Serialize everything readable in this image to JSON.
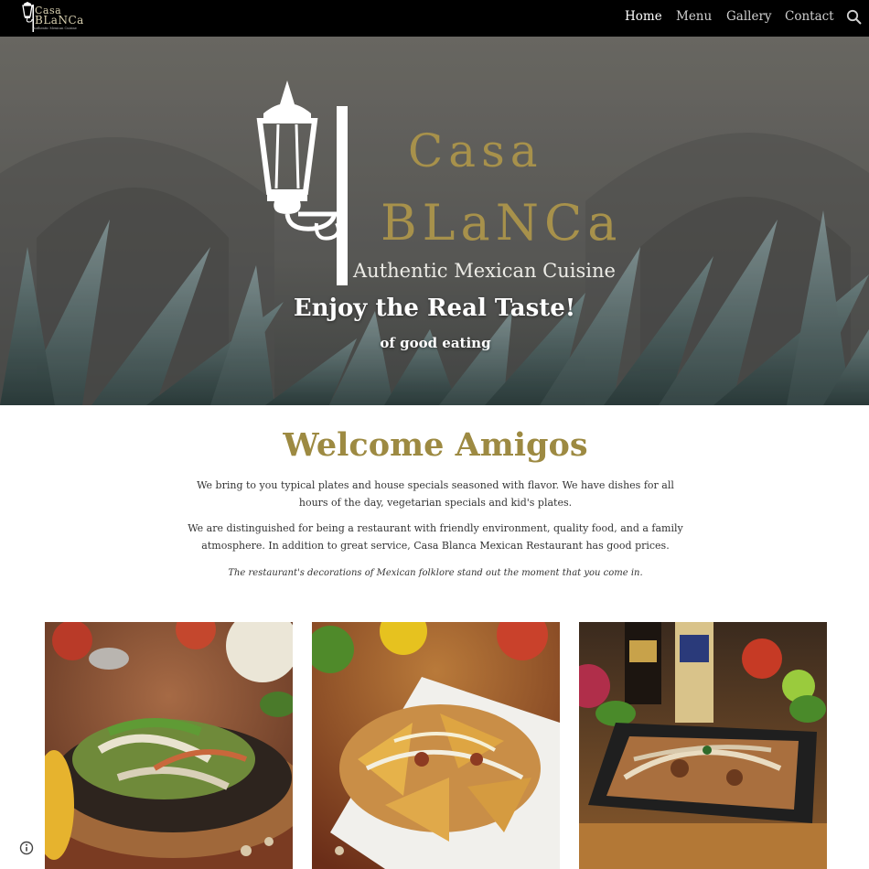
{
  "header": {
    "brand": {
      "line1": "Casa",
      "line2": "BLaNCa",
      "tagline": "Authentic Mexican Cuisine"
    },
    "nav": [
      {
        "label": "Home",
        "active": true
      },
      {
        "label": "Menu",
        "active": false
      },
      {
        "label": "Gallery",
        "active": false
      },
      {
        "label": "Contact",
        "active": false
      }
    ],
    "search_icon": "search-icon"
  },
  "hero": {
    "logo": {
      "word1": "Casa",
      "word2": "BLaNCa",
      "subtitle": "Authentic Mexican Cuisine"
    },
    "title": "Enjoy the Real Taste!",
    "subtitle": "of good eating"
  },
  "welcome": {
    "title": "Welcome Amigos",
    "paragraph1": "We bring to you typical plates and house specials seasoned with flavor. We have dishes for all hours of the day, vegetarian specials and kid's plates.",
    "paragraph2": "We are distinguished for being a restaurant with friendly environment, quality food, and a family atmosphere. In addition to great service, Casa Blanca Mexican Restaurant has good prices.",
    "paragraph3": "The restaurant's decorations of Mexican folklore stand out the moment that you come in."
  },
  "photos": [
    {
      "name": "fajitas-photo"
    },
    {
      "name": "nachos-photo"
    },
    {
      "name": "loaded-nachos-photo"
    }
  ],
  "colors": {
    "accent": "#9d8a42",
    "topbar": "#000000",
    "text": "#333333"
  },
  "footer": {
    "info_icon": "info-icon"
  }
}
